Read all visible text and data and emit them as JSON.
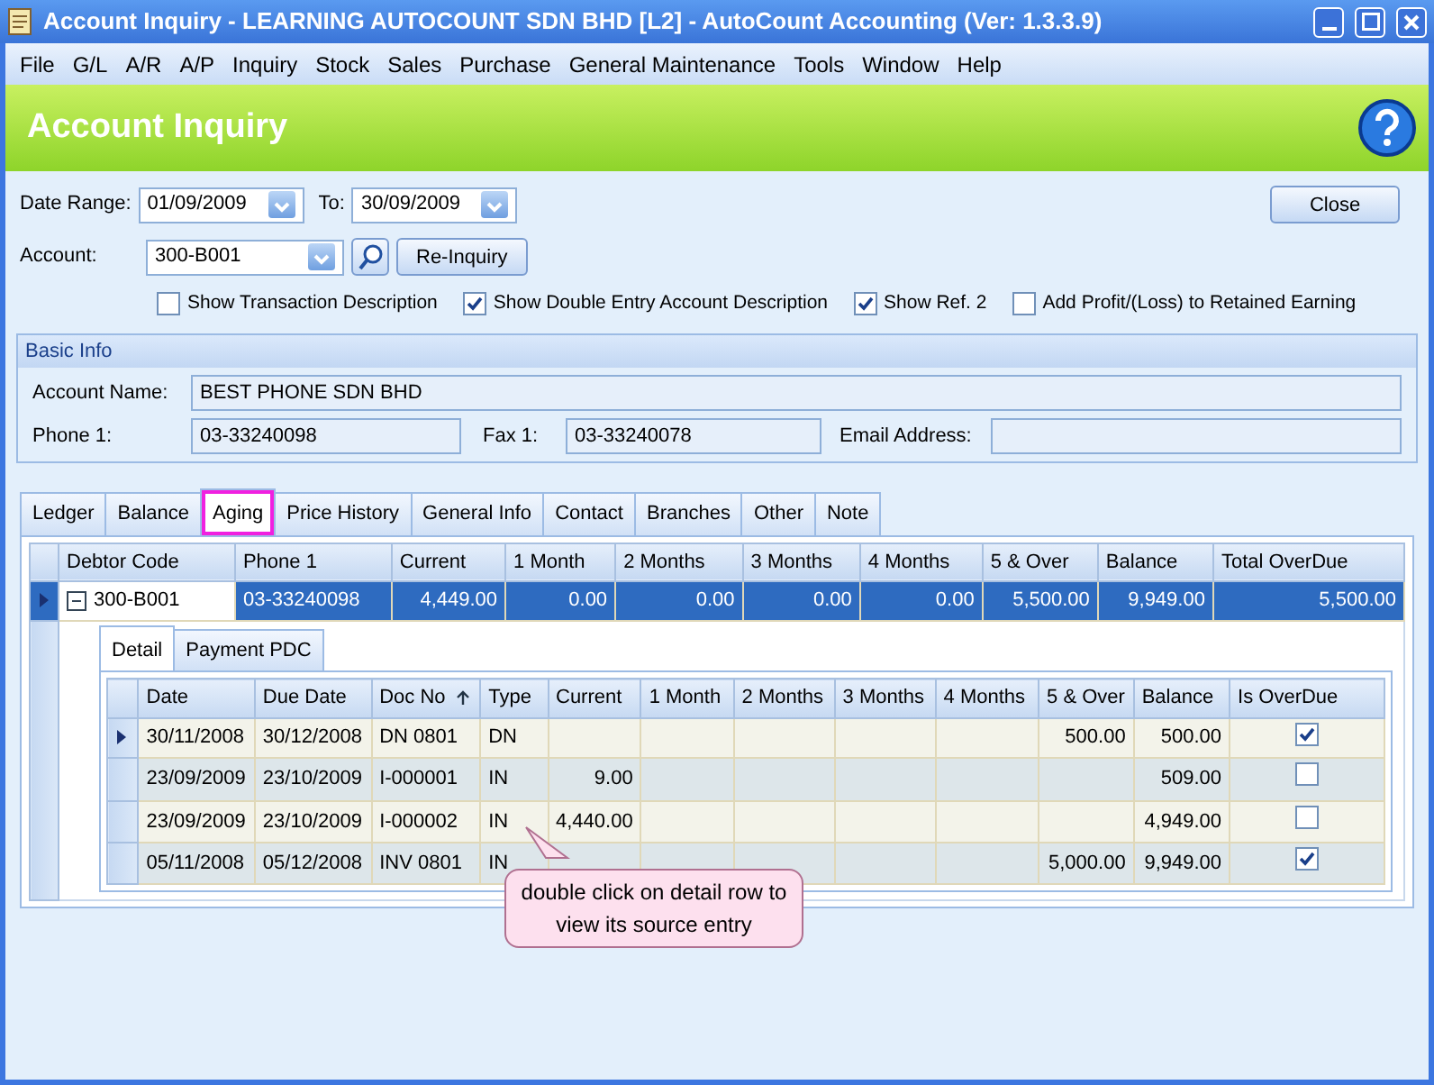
{
  "window": {
    "title": "Account Inquiry - LEARNING AUTOCOUNT SDN BHD [L2] - AutoCount Accounting (Ver: 1.3.3.9)"
  },
  "menu": [
    "File",
    "G/L",
    "A/R",
    "A/P",
    "Inquiry",
    "Stock",
    "Sales",
    "Purchase",
    "General Maintenance",
    "Tools",
    "Window",
    "Help"
  ],
  "header": {
    "title": "Account Inquiry"
  },
  "filters": {
    "date_range_label": "Date Range:",
    "date_from": "01/09/2009",
    "to_label": "To:",
    "date_to": "30/09/2009",
    "account_label": "Account:",
    "account": "300-B001",
    "reinquiry_button": "Re-Inquiry",
    "close_button": "Close"
  },
  "options": [
    {
      "label": "Show Transaction Description",
      "checked": false
    },
    {
      "label": "Show Double Entry Account Description",
      "checked": true
    },
    {
      "label": "Show Ref. 2",
      "checked": true
    },
    {
      "label": "Add Profit/(Loss) to Retained Earning",
      "checked": false
    }
  ],
  "basic_info": {
    "title": "Basic Info",
    "account_name_label": "Account Name:",
    "account_name": "BEST PHONE SDN BHD",
    "phone_label": "Phone 1:",
    "phone": "03-33240098",
    "fax_label": "Fax 1:",
    "fax": "03-33240078",
    "email_label": "Email Address:"
  },
  "tabs": [
    {
      "label": "Ledger",
      "selected": false,
      "highlighted": false
    },
    {
      "label": "Balance",
      "selected": false,
      "highlighted": false
    },
    {
      "label": "Aging",
      "selected": true,
      "highlighted": true
    },
    {
      "label": "Price History",
      "selected": false,
      "highlighted": false
    },
    {
      "label": "General Info",
      "selected": false,
      "highlighted": false
    },
    {
      "label": "Contact",
      "selected": false,
      "highlighted": false
    },
    {
      "label": "Branches",
      "selected": false,
      "highlighted": false
    },
    {
      "label": "Other",
      "selected": false,
      "highlighted": false
    },
    {
      "label": "Note",
      "selected": false,
      "highlighted": false
    }
  ],
  "aging_table": {
    "columns": [
      "Debtor Code",
      "Phone 1",
      "Current",
      "1 Month",
      "2 Months",
      "3 Months",
      "4 Months",
      "5 & Over",
      "Balance",
      "Total OverDue"
    ],
    "rows": [
      {
        "selected": true,
        "expanded": true,
        "cells": [
          "300-B001",
          "03-33240098",
          "4,449.00",
          "0.00",
          "0.00",
          "0.00",
          "0.00",
          "5,500.00",
          "9,949.00",
          "5,500.00"
        ]
      }
    ]
  },
  "detail_tabs": [
    {
      "label": "Detail",
      "selected": true
    },
    {
      "label": "Payment PDC",
      "selected": false
    }
  ],
  "detail_table": {
    "columns": [
      {
        "label": "Date",
        "sorted": false
      },
      {
        "label": "Due Date",
        "sorted": false
      },
      {
        "label": "Doc No",
        "sorted": true
      },
      {
        "label": "Type",
        "sorted": false
      },
      {
        "label": "Current",
        "sorted": false
      },
      {
        "label": "1 Month",
        "sorted": false
      },
      {
        "label": "2 Months",
        "sorted": false
      },
      {
        "label": "3 Months",
        "sorted": false
      },
      {
        "label": "4 Months",
        "sorted": false
      },
      {
        "label": "5 & Over",
        "sorted": false
      },
      {
        "label": "Balance",
        "sorted": false
      },
      {
        "label": "Is OverDue",
        "sorted": false
      }
    ],
    "rows": [
      {
        "current": true,
        "cells": [
          "30/11/2008",
          "30/12/2008",
          "DN 0801",
          "DN",
          "",
          "",
          "",
          "",
          "",
          "500.00",
          "500.00"
        ],
        "is_overdue": true
      },
      {
        "current": false,
        "cells": [
          "23/09/2009",
          "23/10/2009",
          "I-000001",
          "IN",
          "9.00",
          "",
          "",
          "",
          "",
          "",
          "509.00"
        ],
        "is_overdue": false
      },
      {
        "current": false,
        "cells": [
          "23/09/2009",
          "23/10/2009",
          "I-000002",
          "IN",
          "4,440.00",
          "",
          "",
          "",
          "",
          "",
          "4,949.00"
        ],
        "is_overdue": false
      },
      {
        "current": false,
        "cells": [
          "05/11/2008",
          "05/12/2008",
          "INV 0801",
          "IN",
          "",
          "",
          "",
          "",
          "",
          "5,000.00",
          "9,949.00"
        ],
        "is_overdue": true
      }
    ]
  },
  "callout": {
    "text": "double click on detail row to view its source entry"
  }
}
